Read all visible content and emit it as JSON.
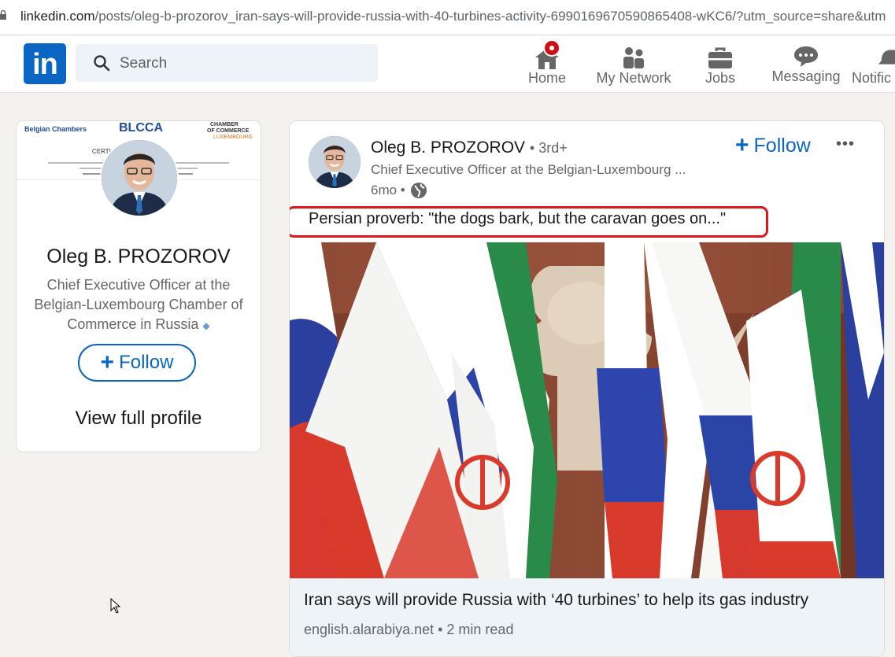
{
  "browser": {
    "url_host": "linkedin.com",
    "url_path": "/posts/oleg-b-prozorov_iran-says-will-provide-russia-with-40-turbines-activity-6990169670590865408-wKC6/?utm_source=share&utm"
  },
  "nav": {
    "logo": "in",
    "search_placeholder": "Search",
    "items": [
      {
        "label": "Home",
        "icon": "home-icon"
      },
      {
        "label": "My Network",
        "icon": "people-icon"
      },
      {
        "label": "Jobs",
        "icon": "briefcase-icon"
      },
      {
        "label": "Messaging",
        "icon": "chat-icon"
      },
      {
        "label": "Notific",
        "icon": "bell-icon"
      }
    ]
  },
  "profile": {
    "cert_left": "Belgian Chambers",
    "cert_middle": "BLCCA",
    "cert_right_1": "CHAMBER",
    "cert_right_2": "OF COMMERCE",
    "cert_right_3": "LUXEMBOURG",
    "cert_title": "CERTI          TATION",
    "name": "Oleg B. PROZOROV",
    "headline": "Chief Executive Officer at the Belgian-Luxembourg Chamber of Commerce in Russia",
    "follow_label": "Follow",
    "view_profile": "View full profile"
  },
  "post": {
    "author": "Oleg B. PROZOROV",
    "degree": "• 3rd+",
    "headline": "Chief Executive Officer at the Belgian-Luxembourg ...",
    "time": "6mo •",
    "follow_label": "Follow",
    "more": "•••",
    "text": "Persian proverb: \"the dogs bark, but the caravan goes on...\"",
    "link_title": "Iran says will provide Russia with ‘40 turbines’ to help its gas industry",
    "link_source": "english.alarabiya.net • 2 min read"
  },
  "colors": {
    "accent": "#0a66c2",
    "highlight": "#e0151b"
  }
}
